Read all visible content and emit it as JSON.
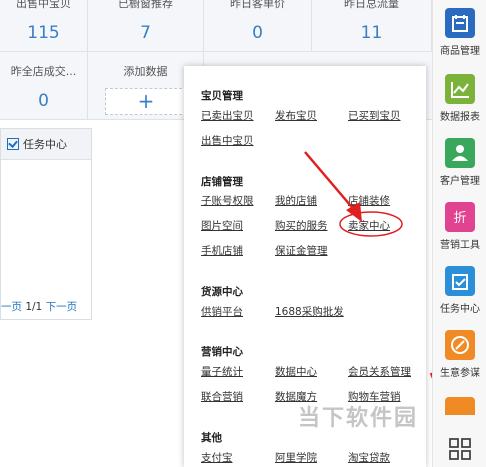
{
  "stats": {
    "row1": [
      {
        "label": "出售中宝贝",
        "value": "115"
      },
      {
        "label": "已橱窗推荐",
        "value": "7"
      },
      {
        "label": "昨日客单价",
        "value": "0"
      },
      {
        "label": "昨日总流量",
        "value": "11"
      }
    ],
    "row2": [
      {
        "label": "昨全店成交...",
        "value": "0"
      },
      {
        "label": "添加数据",
        "value": "+"
      }
    ]
  },
  "task_panel": {
    "title": "任务中心",
    "pager_prev": "一页",
    "pager_page": "1/1",
    "pager_next": "下一页"
  },
  "menu": {
    "sections": [
      {
        "title": "宝贝管理",
        "items": [
          "已卖出宝贝",
          "发布宝贝",
          "已买到宝贝",
          "出售中宝贝"
        ]
      },
      {
        "title": "店铺管理",
        "items": [
          "子账号权限",
          "我的店铺",
          "店铺装修",
          "图片空间",
          "购买的服务",
          "卖家中心",
          "手机店铺",
          "保证金管理"
        ]
      },
      {
        "title": "货源中心",
        "items": [
          "供销平台",
          "1688采购批发"
        ]
      },
      {
        "title": "营销中心",
        "items": [
          "量子统计",
          "数据中心",
          "会员关系管理",
          "联合营销",
          "数据魔方",
          "购物车营销"
        ]
      },
      {
        "title": "其他",
        "items": [
          "支付宝",
          "阿里学院",
          "淘宝贷款"
        ]
      }
    ]
  },
  "sidebar": {
    "items": [
      {
        "label": "商品管理",
        "icon": "product-icon",
        "color": "#2a6bc0"
      },
      {
        "label": "数据报表",
        "icon": "chart-icon",
        "color": "#7bb33a"
      },
      {
        "label": "客户管理",
        "icon": "customer-icon",
        "color": "#3aa85c"
      },
      {
        "label": "营销工具",
        "icon": "discount-icon",
        "color": "#e0438f"
      },
      {
        "label": "任务中心",
        "icon": "task-icon",
        "color": "#2a8fd8"
      },
      {
        "label": "生意参谋",
        "icon": "compass-icon",
        "color": "#f08a24"
      },
      {
        "label": "",
        "icon": "more-icon",
        "color": "#f08a24"
      }
    ]
  },
  "watermark": "当下软件园"
}
